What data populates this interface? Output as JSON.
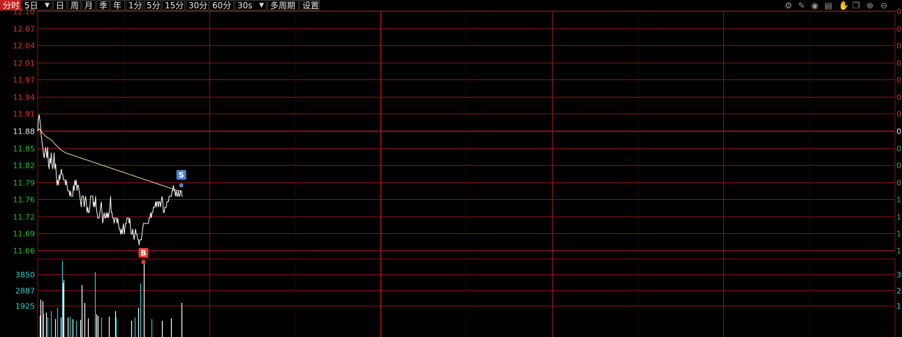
{
  "toolbar": {
    "items": [
      {
        "label": "分时",
        "active": true
      },
      {
        "label": "5日",
        "dropdown": true
      },
      {
        "label": "日"
      },
      {
        "label": "周"
      },
      {
        "label": "月"
      },
      {
        "label": "季"
      },
      {
        "label": "年"
      },
      {
        "label": "1分"
      },
      {
        "label": "5分"
      },
      {
        "label": "15分"
      },
      {
        "label": "30分"
      },
      {
        "label": "60分"
      },
      {
        "label": "30s",
        "dropdown": true
      },
      {
        "label": "多周期"
      },
      {
        "label": "设置"
      }
    ],
    "tool_icons": [
      {
        "name": "gear-icon",
        "glyph": "⚙"
      },
      {
        "name": "pen-icon",
        "glyph": "✎"
      },
      {
        "name": "eye-icon",
        "glyph": "◉"
      },
      {
        "name": "archive-icon",
        "glyph": "▤"
      },
      {
        "name": "hand-icon",
        "glyph": "✋"
      },
      {
        "name": "restore-icon",
        "glyph": "❐"
      },
      {
        "name": "zoom-in-icon",
        "glyph": "⊕"
      },
      {
        "name": "zoom-out-icon",
        "glyph": "⊖"
      }
    ]
  },
  "colors": {
    "background": "#000000",
    "grid": "#8c1414",
    "grid_dotted": "#5a1010",
    "axis_up": "#e03030",
    "axis_down": "#20c020",
    "axis_mid": "#e8e8e8",
    "price_line": "#ffffff",
    "avg_line": "#e8e3a0",
    "volume_up": "#ffffff",
    "volume_down": "#33cccc",
    "volume_label": "#33cccc",
    "buy_marker": "#e8412e",
    "sell_marker": "#4a86c8"
  },
  "chart_data": [
    {
      "type": "line",
      "name": "price",
      "ylim": [
        11.66,
        12.1
      ],
      "y_ticks": [
        "12.10",
        "12.07",
        "12.04",
        "12.01",
        "11.97",
        "11.94",
        "11.91",
        "11.88",
        "11.85",
        "11.82",
        "11.79",
        "11.76",
        "11.72",
        "11.69",
        "11.66"
      ],
      "prev_close": 11.88,
      "days": 5,
      "x_count": 241,
      "series": [
        {
          "key": "price",
          "values": [
            11.88,
            11.9,
            11.91,
            11.9,
            11.89,
            11.87,
            11.86,
            11.85,
            11.84,
            11.83,
            11.84,
            11.85,
            11.84,
            11.83,
            11.85,
            11.82,
            11.81,
            11.83,
            11.82,
            11.84,
            11.82,
            11.81,
            11.82,
            11.84,
            11.81,
            11.82,
            11.8,
            11.78,
            11.79,
            11.78,
            11.8,
            11.79,
            11.8,
            11.81,
            11.8,
            11.8,
            11.79,
            11.79,
            11.79,
            11.78,
            11.79,
            11.78,
            11.77,
            11.77,
            11.77,
            11.76,
            11.77,
            11.76,
            11.76,
            11.76,
            11.78,
            11.77,
            11.79,
            11.78,
            11.79,
            11.77,
            11.78,
            11.78,
            11.77,
            11.76,
            11.75,
            11.74,
            11.76,
            11.76,
            11.76,
            11.74,
            11.75,
            11.76,
            11.75,
            11.73,
            11.74,
            11.73,
            11.73,
            11.74,
            11.76,
            11.76,
            11.76,
            11.76,
            11.74,
            11.75,
            11.74,
            11.76,
            11.74,
            11.73,
            11.72,
            11.72,
            11.72,
            11.73,
            11.74,
            11.75,
            11.73,
            11.71,
            11.72,
            11.73,
            11.72,
            11.72,
            11.73,
            11.72,
            11.73,
            11.72,
            11.73,
            11.74,
            11.76,
            11.73,
            11.73,
            11.72,
            11.72,
            11.71,
            11.72,
            11.72,
            11.72,
            11.71,
            11.72,
            11.71,
            11.7,
            11.7,
            11.69,
            11.7,
            11.69,
            11.7,
            11.71,
            11.69,
            11.7,
            11.71,
            11.71,
            11.72,
            11.72,
            11.72,
            11.71,
            11.72,
            11.7,
            11.69,
            11.69,
            11.7,
            11.69,
            11.68,
            11.69,
            11.7,
            11.69,
            11.69,
            11.68,
            11.68,
            11.67,
            11.68,
            11.68,
            11.68,
            11.69,
            11.7,
            11.71,
            11.71,
            11.71,
            11.71,
            11.71,
            11.71,
            11.71,
            11.71,
            11.72,
            11.72,
            11.73,
            11.72,
            11.73,
            11.73,
            11.74,
            11.74,
            11.74,
            11.75,
            11.74,
            11.75,
            11.75,
            11.74,
            11.75,
            11.75,
            11.74,
            11.75,
            11.76,
            11.75,
            11.73,
            11.73,
            11.74,
            11.74,
            11.74,
            11.75,
            11.75,
            11.75,
            11.76,
            11.76,
            11.76,
            11.76,
            11.77,
            11.77,
            11.78,
            11.77,
            11.77,
            11.76,
            11.77,
            11.76,
            11.76,
            11.77,
            11.76,
            11.76,
            11.77,
            11.77,
            11.76,
            11.76
          ]
        },
        {
          "key": "average",
          "values": [
            11.88,
            11.884,
            11.88,
            11.876,
            11.873,
            11.87,
            11.868,
            11.866,
            11.864,
            11.862,
            11.858,
            11.855,
            11.852,
            11.849,
            11.846,
            11.844,
            11.842,
            11.84,
            11.839,
            11.838,
            11.837,
            11.836,
            11.835,
            11.834,
            11.833,
            11.832,
            11.831,
            11.83,
            11.829,
            11.828,
            11.827,
            11.826,
            11.825,
            11.824,
            11.823,
            11.822,
            11.821,
            11.82,
            11.819,
            11.818,
            11.817,
            11.816,
            11.815,
            11.814,
            11.813,
            11.812,
            11.811,
            11.81,
            11.809,
            11.808,
            11.807,
            11.806,
            11.805,
            11.804,
            11.803,
            11.802,
            11.801,
            11.8,
            11.799,
            11.798,
            11.797,
            11.796,
            11.795,
            11.794,
            11.793,
            11.792,
            11.791,
            11.79,
            11.789,
            11.788,
            11.787,
            11.786,
            11.785,
            11.784,
            11.783,
            11.782,
            11.781,
            11.78,
            11.779,
            11.778,
            11.777,
            11.776,
            11.775,
            11.774,
            11.773,
            11.772,
            11.771,
            11.77,
            11.77,
            11.77
          ]
        }
      ],
      "markers": [
        {
          "label": "B",
          "type": "buy",
          "x_index": 148,
          "price": 11.67
        },
        {
          "label": "S",
          "type": "sell",
          "x_index": 201,
          "price": 11.78
        }
      ]
    },
    {
      "type": "bar",
      "name": "volume",
      "y_ticks": [
        "3850",
        "2887",
        "1925"
      ],
      "ylim": [
        0,
        4800
      ],
      "bars": [
        {
          "x_index": 3,
          "value": 1300,
          "dir": "up"
        },
        {
          "x_index": 4,
          "value": 2300,
          "dir": "up"
        },
        {
          "x_index": 7,
          "value": 2200,
          "dir": "up"
        },
        {
          "x_index": 8,
          "value": 1400,
          "dir": "down"
        },
        {
          "x_index": 12,
          "value": 1500,
          "dir": "up"
        },
        {
          "x_index": 14,
          "value": 1200,
          "dir": "down"
        },
        {
          "x_index": 19,
          "value": 1600,
          "dir": "down"
        },
        {
          "x_index": 24,
          "value": 1100,
          "dir": "up"
        },
        {
          "x_index": 27,
          "value": 1800,
          "dir": "down"
        },
        {
          "x_index": 32,
          "value": 1200,
          "dir": "up"
        },
        {
          "x_index": 34,
          "value": 4700,
          "dir": "down"
        },
        {
          "x_index": 35,
          "value": 3300,
          "dir": "up"
        },
        {
          "x_index": 36,
          "value": 3500,
          "dir": "up"
        },
        {
          "x_index": 42,
          "value": 1200,
          "dir": "up"
        },
        {
          "x_index": 45,
          "value": 1250,
          "dir": "down"
        },
        {
          "x_index": 49,
          "value": 1100,
          "dir": "up"
        },
        {
          "x_index": 54,
          "value": 1000,
          "dir": "down"
        },
        {
          "x_index": 60,
          "value": 1050,
          "dir": "up"
        },
        {
          "x_index": 62,
          "value": 3200,
          "dir": "up"
        },
        {
          "x_index": 65,
          "value": 2100,
          "dir": "up"
        },
        {
          "x_index": 70,
          "value": 1150,
          "dir": "up"
        },
        {
          "x_index": 80,
          "value": 4000,
          "dir": "down"
        },
        {
          "x_index": 82,
          "value": 1400,
          "dir": "up"
        },
        {
          "x_index": 84,
          "value": 1300,
          "dir": "up"
        },
        {
          "x_index": 89,
          "value": 1200,
          "dir": "down"
        },
        {
          "x_index": 100,
          "value": 1250,
          "dir": "up"
        },
        {
          "x_index": 108,
          "value": 1600,
          "dir": "up"
        },
        {
          "x_index": 109,
          "value": 1200,
          "dir": "down"
        },
        {
          "x_index": 131,
          "value": 1000,
          "dir": "up"
        },
        {
          "x_index": 136,
          "value": 1200,
          "dir": "down"
        },
        {
          "x_index": 141,
          "value": 1800,
          "dir": "up"
        },
        {
          "x_index": 144,
          "value": 3300,
          "dir": "down"
        },
        {
          "x_index": 149,
          "value": 4600,
          "dir": "up"
        },
        {
          "x_index": 159,
          "value": 1100,
          "dir": "down"
        },
        {
          "x_index": 174,
          "value": 1000,
          "dir": "up"
        },
        {
          "x_index": 187,
          "value": 1150,
          "dir": "up"
        },
        {
          "x_index": 201,
          "value": 2100,
          "dir": "up"
        }
      ]
    }
  ]
}
